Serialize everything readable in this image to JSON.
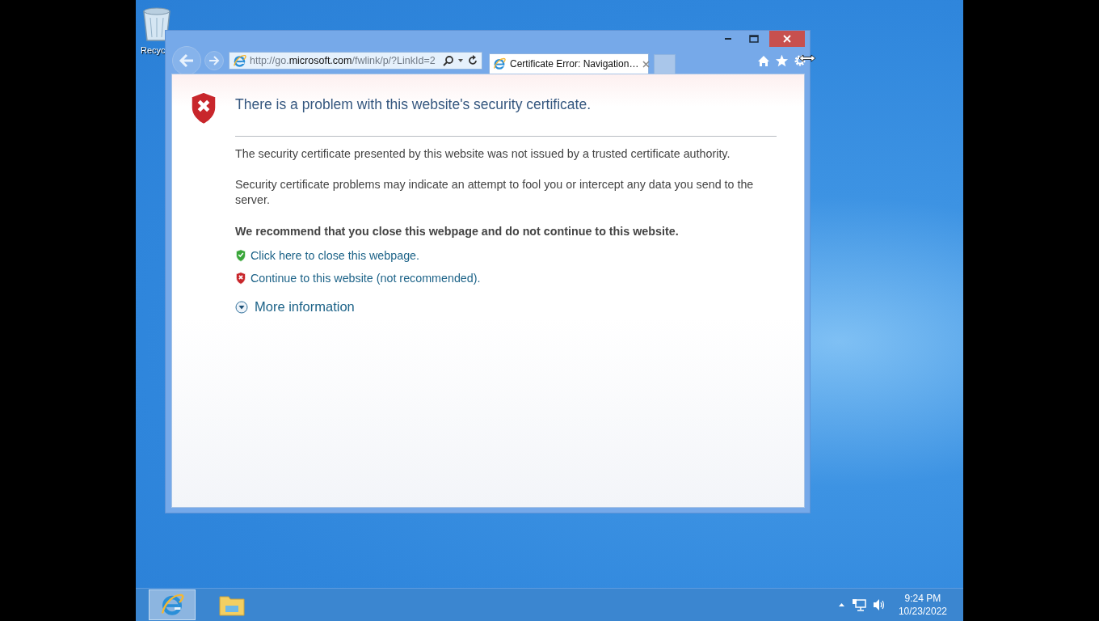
{
  "desktop_icons": [
    {
      "label": "Recyc"
    }
  ],
  "browser": {
    "address_bar": {
      "url": "http://go.**microsoft.com**/fwlink/p/?LinkId=2"
    },
    "tabs": [
      {
        "title": "Certificate Error: Navigation…",
        "selected": true
      }
    ]
  },
  "page": {
    "heading": "There is a problem with this website's security certificate.",
    "paragraphs": [
      "The security certificate presented by this website was not issued by a trusted certificate authority.",
      "Security certificate problems may indicate an attempt to fool you or intercept any data you send to the server."
    ],
    "recommendation": "We recommend that you close this webpage and do not continue to this website.",
    "links": [
      {
        "kind": "safe",
        "text": "Click here to close this webpage."
      },
      {
        "kind": "unsafe",
        "text": "Continue to this website (not recommended)."
      }
    ],
    "more_info": {
      "label": "More information",
      "expanded": false
    }
  },
  "taskbar": {
    "apps": [
      {
        "kind": "browser",
        "selected": true
      },
      {
        "kind": "folder",
        "selected": false
      }
    ],
    "clock": {
      "time": "9:24 PM",
      "date": "10/23/2022"
    }
  }
}
